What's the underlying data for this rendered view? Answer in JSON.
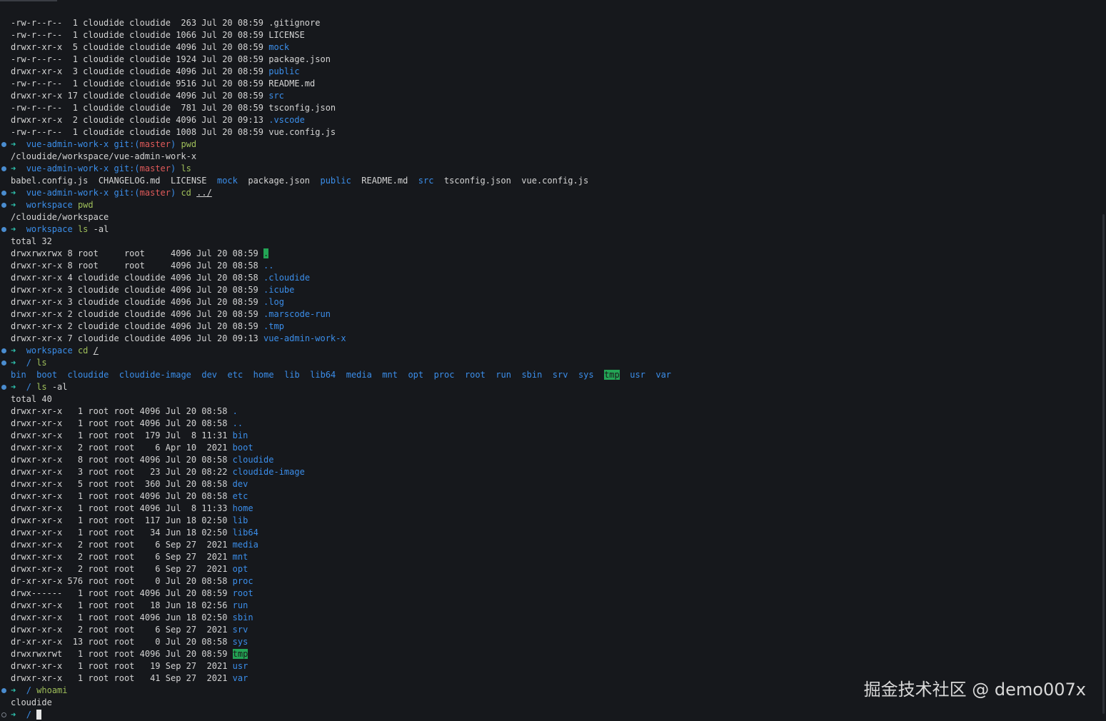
{
  "colors": {
    "background": "#16181c",
    "text": "#d4d4d4",
    "directory": "#3b8eea",
    "prompt_arrow": "#2ec2ae",
    "command": "#9fbf5a",
    "branch": "#e05a5a",
    "highlight": "#23a455"
  },
  "watermark": "掘金技术社区 @ demo007x",
  "lines": [
    {
      "segs": [
        {
          "t": "-rw-r--r--  1 cloudide cloudide  263 Jul 20 08:59 .gitignore"
        }
      ]
    },
    {
      "segs": [
        {
          "t": "-rw-r--r--  1 cloudide cloudide 1066 Jul 20 08:59 LICENSE"
        }
      ]
    },
    {
      "segs": [
        {
          "t": "drwxr-xr-x  5 cloudide cloudide 4096 Jul 20 08:59 "
        },
        {
          "t": "mock",
          "c": "blue"
        }
      ]
    },
    {
      "segs": [
        {
          "t": "-rw-r--r--  1 cloudide cloudide 1924 Jul 20 08:59 package.json"
        }
      ]
    },
    {
      "segs": [
        {
          "t": "drwxr-xr-x  3 cloudide cloudide 4096 Jul 20 08:59 "
        },
        {
          "t": "public",
          "c": "blue"
        }
      ]
    },
    {
      "segs": [
        {
          "t": "-rw-r--r--  1 cloudide cloudide 9516 Jul 20 08:59 README.md"
        }
      ]
    },
    {
      "segs": [
        {
          "t": "drwxr-xr-x 17 cloudide cloudide 4096 Jul 20 08:59 "
        },
        {
          "t": "src",
          "c": "blue"
        }
      ]
    },
    {
      "segs": [
        {
          "t": "-rw-r--r--  1 cloudide cloudide  781 Jul 20 08:59 tsconfig.json"
        }
      ]
    },
    {
      "segs": [
        {
          "t": "drwxr-xr-x  2 cloudide cloudide 4096 Jul 20 09:13 "
        },
        {
          "t": ".vscode",
          "c": "blue"
        }
      ]
    },
    {
      "segs": [
        {
          "t": "-rw-r--r--  1 cloudide cloudide 1008 Jul 20 08:59 vue.config.js"
        }
      ]
    },
    {
      "dot": "done",
      "segs": [
        {
          "t": "➜  ",
          "c": "arrow"
        },
        {
          "t": "vue-admin-work-x",
          "c": "dir-name"
        },
        {
          "t": " git:(",
          "c": "dir-name"
        },
        {
          "t": "master",
          "c": "branch"
        },
        {
          "t": ")",
          "c": "dir-name"
        },
        {
          "t": " pwd",
          "c": "cmd"
        }
      ]
    },
    {
      "segs": [
        {
          "t": "/cloudide/workspace/vue-admin-work-x"
        }
      ]
    },
    {
      "dot": "done",
      "segs": [
        {
          "t": "➜  ",
          "c": "arrow"
        },
        {
          "t": "vue-admin-work-x",
          "c": "dir-name"
        },
        {
          "t": " git:(",
          "c": "dir-name"
        },
        {
          "t": "master",
          "c": "branch"
        },
        {
          "t": ")",
          "c": "dir-name"
        },
        {
          "t": " ls",
          "c": "cmd"
        }
      ]
    },
    {
      "segs": [
        {
          "t": "babel.config.js  CHANGELOG.md  LICENSE  "
        },
        {
          "t": "mock",
          "c": "blue"
        },
        {
          "t": "  package.json  "
        },
        {
          "t": "public",
          "c": "blue"
        },
        {
          "t": "  README.md  "
        },
        {
          "t": "src",
          "c": "blue"
        },
        {
          "t": "  tsconfig.json  vue.config.js"
        }
      ]
    },
    {
      "dot": "done",
      "segs": [
        {
          "t": "➜  ",
          "c": "arrow"
        },
        {
          "t": "vue-admin-work-x",
          "c": "dir-name"
        },
        {
          "t": " git:(",
          "c": "dir-name"
        },
        {
          "t": "master",
          "c": "branch"
        },
        {
          "t": ")",
          "c": "dir-name"
        },
        {
          "t": " cd ",
          "c": "cmd"
        },
        {
          "t": "../",
          "c": "u"
        }
      ]
    },
    {
      "dot": "done",
      "segs": [
        {
          "t": "➜  ",
          "c": "arrow"
        },
        {
          "t": "workspace",
          "c": "dir-name"
        },
        {
          "t": " pwd",
          "c": "cmd"
        }
      ]
    },
    {
      "segs": [
        {
          "t": "/cloudide/workspace"
        }
      ]
    },
    {
      "dot": "done",
      "segs": [
        {
          "t": "➜  ",
          "c": "arrow"
        },
        {
          "t": "workspace",
          "c": "dir-name"
        },
        {
          "t": " ls",
          "c": "cmd"
        },
        {
          "t": " -al"
        }
      ]
    },
    {
      "segs": [
        {
          "t": "total 32"
        }
      ]
    },
    {
      "segs": [
        {
          "t": "drwxrwxrwx 8 root     root     4096 Jul 20 08:59 "
        },
        {
          "t": ".",
          "c": "hl"
        }
      ]
    },
    {
      "segs": [
        {
          "t": "drwxr-xr-x 8 root     root     4096 Jul 20 08:58 "
        },
        {
          "t": "..",
          "c": "blue"
        }
      ]
    },
    {
      "segs": [
        {
          "t": "drwxr-xr-x 4 cloudide cloudide 4096 Jul 20 08:58 "
        },
        {
          "t": ".cloudide",
          "c": "blue"
        }
      ]
    },
    {
      "segs": [
        {
          "t": "drwxr-xr-x 3 cloudide cloudide 4096 Jul 20 08:59 "
        },
        {
          "t": ".icube",
          "c": "blue"
        }
      ]
    },
    {
      "segs": [
        {
          "t": "drwxr-xr-x 3 cloudide cloudide 4096 Jul 20 08:59 "
        },
        {
          "t": ".log",
          "c": "blue"
        }
      ]
    },
    {
      "segs": [
        {
          "t": "drwxr-xr-x 2 cloudide cloudide 4096 Jul 20 08:59 "
        },
        {
          "t": ".marscode-run",
          "c": "blue"
        }
      ]
    },
    {
      "segs": [
        {
          "t": "drwxr-xr-x 2 cloudide cloudide 4096 Jul 20 08:59 "
        },
        {
          "t": ".tmp",
          "c": "blue"
        }
      ]
    },
    {
      "segs": [
        {
          "t": "drwxr-xr-x 7 cloudide cloudide 4096 Jul 20 09:13 "
        },
        {
          "t": "vue-admin-work-x",
          "c": "blue"
        }
      ]
    },
    {
      "dot": "done",
      "segs": [
        {
          "t": "➜  ",
          "c": "arrow"
        },
        {
          "t": "workspace",
          "c": "dir-name"
        },
        {
          "t": " cd ",
          "c": "cmd"
        },
        {
          "t": "/",
          "c": "u"
        }
      ]
    },
    {
      "dot": "done",
      "segs": [
        {
          "t": "➜  ",
          "c": "arrow"
        },
        {
          "t": "/",
          "c": "dir-name"
        },
        {
          "t": " ls",
          "c": "cmd"
        }
      ]
    },
    {
      "segs": [
        {
          "t": "bin",
          "c": "blue"
        },
        {
          "t": "  "
        },
        {
          "t": "boot",
          "c": "blue"
        },
        {
          "t": "  "
        },
        {
          "t": "cloudide",
          "c": "blue"
        },
        {
          "t": "  "
        },
        {
          "t": "cloudide-image",
          "c": "blue"
        },
        {
          "t": "  "
        },
        {
          "t": "dev",
          "c": "blue"
        },
        {
          "t": "  "
        },
        {
          "t": "etc",
          "c": "blue"
        },
        {
          "t": "  "
        },
        {
          "t": "home",
          "c": "blue"
        },
        {
          "t": "  "
        },
        {
          "t": "lib",
          "c": "blue"
        },
        {
          "t": "  "
        },
        {
          "t": "lib64",
          "c": "blue"
        },
        {
          "t": "  "
        },
        {
          "t": "media",
          "c": "blue"
        },
        {
          "t": "  "
        },
        {
          "t": "mnt",
          "c": "blue"
        },
        {
          "t": "  "
        },
        {
          "t": "opt",
          "c": "blue"
        },
        {
          "t": "  "
        },
        {
          "t": "proc",
          "c": "blue"
        },
        {
          "t": "  "
        },
        {
          "t": "root",
          "c": "blue"
        },
        {
          "t": "  "
        },
        {
          "t": "run",
          "c": "blue"
        },
        {
          "t": "  "
        },
        {
          "t": "sbin",
          "c": "blue"
        },
        {
          "t": "  "
        },
        {
          "t": "srv",
          "c": "blue"
        },
        {
          "t": "  "
        },
        {
          "t": "sys",
          "c": "blue"
        },
        {
          "t": "  "
        },
        {
          "t": "tmp",
          "c": "hl"
        },
        {
          "t": "  "
        },
        {
          "t": "usr",
          "c": "blue"
        },
        {
          "t": "  "
        },
        {
          "t": "var",
          "c": "blue"
        }
      ]
    },
    {
      "dot": "done",
      "segs": [
        {
          "t": "➜  ",
          "c": "arrow"
        },
        {
          "t": "/",
          "c": "dir-name"
        },
        {
          "t": " ls",
          "c": "cmd"
        },
        {
          "t": " -al"
        }
      ]
    },
    {
      "segs": [
        {
          "t": "total 40"
        }
      ]
    },
    {
      "segs": [
        {
          "t": "drwxr-xr-x   1 root root 4096 Jul 20 08:58 "
        },
        {
          "t": ".",
          "c": "blue"
        }
      ]
    },
    {
      "segs": [
        {
          "t": "drwxr-xr-x   1 root root 4096 Jul 20 08:58 "
        },
        {
          "t": "..",
          "c": "blue"
        }
      ]
    },
    {
      "segs": [
        {
          "t": "drwxr-xr-x   1 root root  179 Jul  8 11:31 "
        },
        {
          "t": "bin",
          "c": "blue"
        }
      ]
    },
    {
      "segs": [
        {
          "t": "drwxr-xr-x   2 root root    6 Apr 10  2021 "
        },
        {
          "t": "boot",
          "c": "blue"
        }
      ]
    },
    {
      "segs": [
        {
          "t": "drwxr-xr-x   8 root root 4096 Jul 20 08:58 "
        },
        {
          "t": "cloudide",
          "c": "blue"
        }
      ]
    },
    {
      "segs": [
        {
          "t": "drwxr-xr-x   3 root root   23 Jul 20 08:22 "
        },
        {
          "t": "cloudide-image",
          "c": "blue"
        }
      ]
    },
    {
      "segs": [
        {
          "t": "drwxr-xr-x   5 root root  360 Jul 20 08:58 "
        },
        {
          "t": "dev",
          "c": "blue"
        }
      ]
    },
    {
      "segs": [
        {
          "t": "drwxr-xr-x   1 root root 4096 Jul 20 08:58 "
        },
        {
          "t": "etc",
          "c": "blue"
        }
      ]
    },
    {
      "segs": [
        {
          "t": "drwxr-xr-x   1 root root 4096 Jul  8 11:33 "
        },
        {
          "t": "home",
          "c": "blue"
        }
      ]
    },
    {
      "segs": [
        {
          "t": "drwxr-xr-x   1 root root  117 Jun 18 02:50 "
        },
        {
          "t": "lib",
          "c": "blue"
        }
      ]
    },
    {
      "segs": [
        {
          "t": "drwxr-xr-x   1 root root   34 Jun 18 02:50 "
        },
        {
          "t": "lib64",
          "c": "blue"
        }
      ]
    },
    {
      "segs": [
        {
          "t": "drwxr-xr-x   2 root root    6 Sep 27  2021 "
        },
        {
          "t": "media",
          "c": "blue"
        }
      ]
    },
    {
      "segs": [
        {
          "t": "drwxr-xr-x   2 root root    6 Sep 27  2021 "
        },
        {
          "t": "mnt",
          "c": "blue"
        }
      ]
    },
    {
      "segs": [
        {
          "t": "drwxr-xr-x   2 root root    6 Sep 27  2021 "
        },
        {
          "t": "opt",
          "c": "blue"
        }
      ]
    },
    {
      "segs": [
        {
          "t": "dr-xr-xr-x 576 root root    0 Jul 20 08:58 "
        },
        {
          "t": "proc",
          "c": "blue"
        }
      ]
    },
    {
      "segs": [
        {
          "t": "drwx------   1 root root 4096 Jul 20 08:59 "
        },
        {
          "t": "root",
          "c": "blue"
        }
      ]
    },
    {
      "segs": [
        {
          "t": "drwxr-xr-x   1 root root   18 Jun 18 02:56 "
        },
        {
          "t": "run",
          "c": "blue"
        }
      ]
    },
    {
      "segs": [
        {
          "t": "drwxr-xr-x   1 root root 4096 Jun 18 02:50 "
        },
        {
          "t": "sbin",
          "c": "blue"
        }
      ]
    },
    {
      "segs": [
        {
          "t": "drwxr-xr-x   2 root root    6 Sep 27  2021 "
        },
        {
          "t": "srv",
          "c": "blue"
        }
      ]
    },
    {
      "segs": [
        {
          "t": "dr-xr-xr-x  13 root root    0 Jul 20 08:58 "
        },
        {
          "t": "sys",
          "c": "blue"
        }
      ]
    },
    {
      "segs": [
        {
          "t": "drwxrwxrwt   1 root root 4096 Jul 20 08:59 "
        },
        {
          "t": "tmp",
          "c": "hl"
        }
      ]
    },
    {
      "segs": [
        {
          "t": "drwxr-xr-x   1 root root   19 Sep 27  2021 "
        },
        {
          "t": "usr",
          "c": "blue"
        }
      ]
    },
    {
      "segs": [
        {
          "t": "drwxr-xr-x   1 root root   41 Sep 27  2021 "
        },
        {
          "t": "var",
          "c": "blue"
        }
      ]
    },
    {
      "dot": "done",
      "segs": [
        {
          "t": "➜  ",
          "c": "arrow"
        },
        {
          "t": "/",
          "c": "dir-name"
        },
        {
          "t": " whoami",
          "c": "cmd"
        }
      ]
    },
    {
      "segs": [
        {
          "t": "cloudide"
        }
      ]
    },
    {
      "dot": "open",
      "cursor": true,
      "segs": [
        {
          "t": "➜  ",
          "c": "arrow"
        },
        {
          "t": "/",
          "c": "dir-name"
        },
        {
          "t": " "
        }
      ]
    }
  ]
}
